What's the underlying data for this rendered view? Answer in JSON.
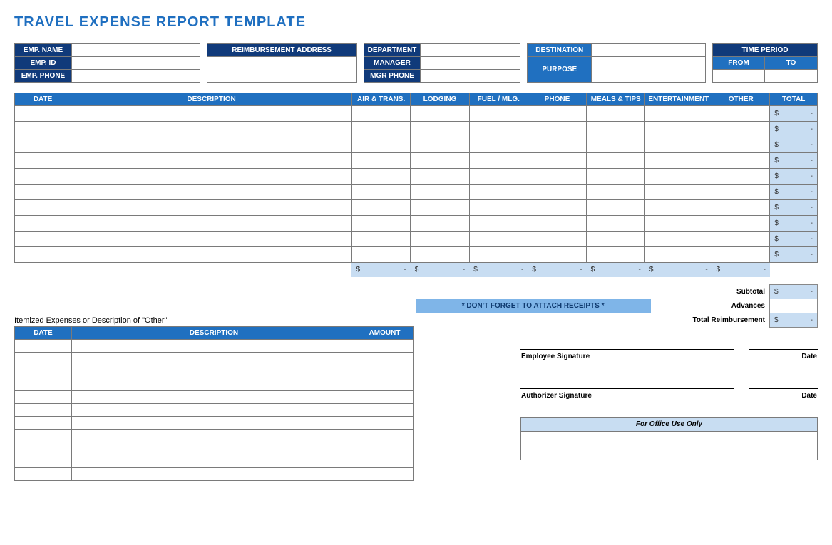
{
  "title": "TRAVEL EXPENSE REPORT TEMPLATE",
  "info": {
    "emp_name": "EMP. NAME",
    "emp_id": "EMP. ID",
    "emp_phone": "EMP. PHONE",
    "reimb_addr": "REIMBURSEMENT ADDRESS",
    "department": "DEPARTMENT",
    "manager": "MANAGER",
    "mgr_phone": "MGR PHONE",
    "destination": "DESTINATION",
    "purpose": "PURPOSE",
    "time_period": "TIME PERIOD",
    "from": "FROM",
    "to": "TO"
  },
  "cols": {
    "date": "DATE",
    "description": "DESCRIPTION",
    "air": "AIR & TRANS.",
    "lodging": "LODGING",
    "fuel": "FUEL / MLG.",
    "phone": "PHONE",
    "meals": "MEALS & TIPS",
    "ent": "ENTERTAINMENT",
    "other": "OTHER",
    "total": "TOTAL",
    "amount": "AMOUNT"
  },
  "currency": "$",
  "dash": "-",
  "reminder": "* DON'T FORGET TO ATTACH RECEIPTS *",
  "summary": {
    "subtotal": "Subtotal",
    "advances": "Advances",
    "total_reimb": "Total Reimbursement"
  },
  "itemized_title": "Itemized Expenses or Description of \"Other\"",
  "sig": {
    "employee": "Employee Signature",
    "authorizer": "Authorizer Signature",
    "date": "Date"
  },
  "office": "For Office Use Only"
}
